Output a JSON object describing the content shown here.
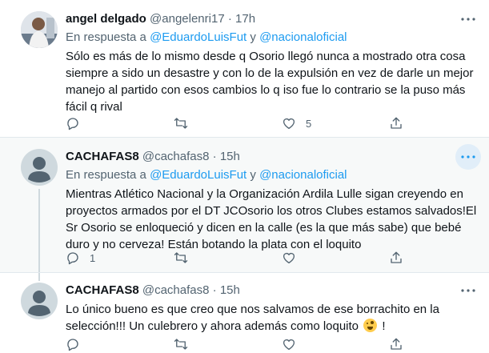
{
  "tweets": [
    {
      "name": "angel delgado",
      "handle": "@angelenri17",
      "separator": "·",
      "time": "17h",
      "reply_prefix": "En respuesta a",
      "mention1": "@EduardoLuisFut",
      "reply_joiner": "y",
      "mention2": "@nacionaloficial",
      "text": "Sólo es más de lo mismo desde q Osorio llegó nunca a mostrado otra cosa siempre a sido un desastre y con lo de la expulsión en vez de darle un mejor manejo al partido con esos cambios lo q iso fue lo contrario se la puso más fácil q rival",
      "likes": "5"
    },
    {
      "name": "CACHAFAS8",
      "handle": "@cachafas8",
      "separator": "·",
      "time": "15h",
      "reply_prefix": "En respuesta a",
      "mention1": "@EduardoLuisFut",
      "reply_joiner": "y",
      "mention2": "@nacionaloficial",
      "text": "Mientras Atlético Nacional y la Organización Ardila Lulle sigan creyendo en proyectos armados por el DT JCOsorio los otros Clubes estamos salvados!El Sr Osorio se enloqueció y dicen en la calle (es la que más sabe) que bebé duro y no cerveza! Están botando la plata con el loquito",
      "replies": "1"
    },
    {
      "name": "CACHAFAS8",
      "handle": "@cachafas8",
      "separator": "·",
      "time": "15h",
      "text": "Lo único bueno es que creo que nos salvamos de ese borrachito en la selección!!! Un culebrero y ahora además como loquito",
      "text_suffix": "!"
    }
  ]
}
